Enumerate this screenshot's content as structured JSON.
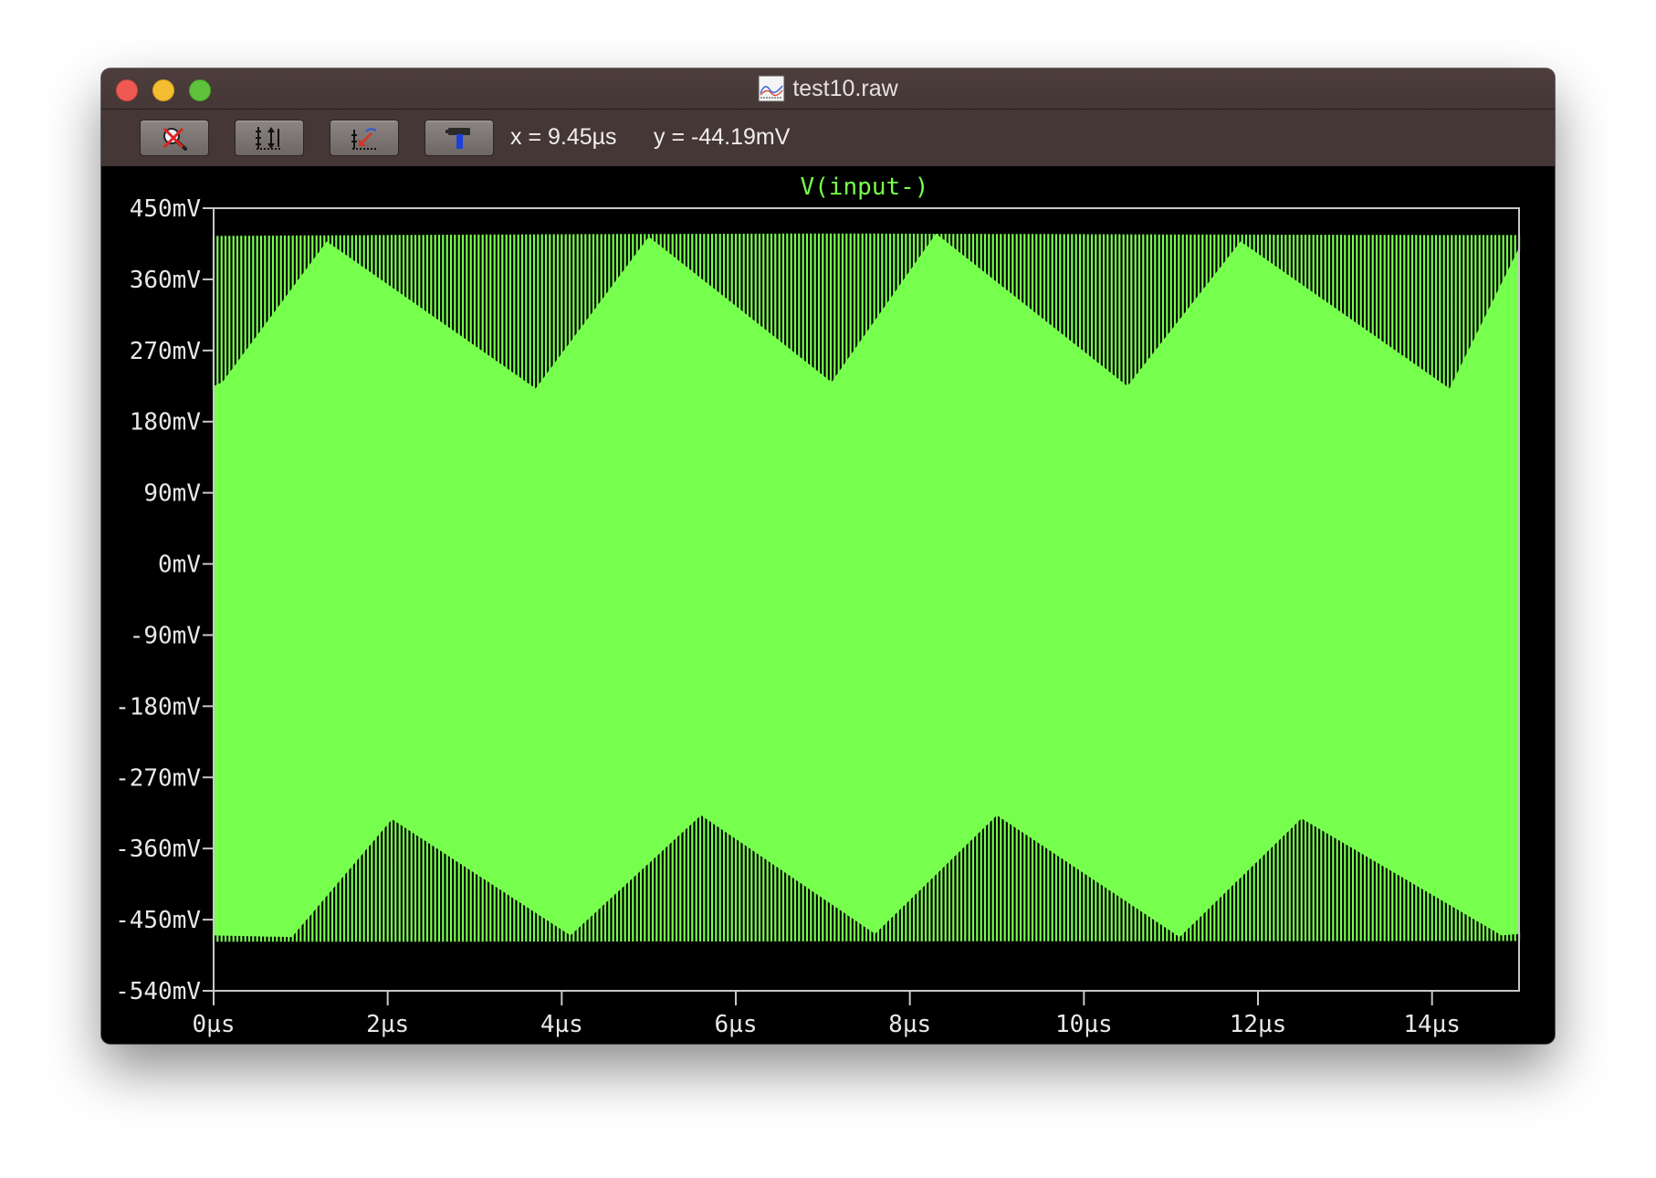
{
  "window": {
    "title": "test10.raw"
  },
  "toolbar": {
    "buttons": [
      {
        "name": "zoom-cancel",
        "icon": "magnifier-cancel-icon"
      },
      {
        "name": "autorange-y",
        "icon": "autorange-y-icon"
      },
      {
        "name": "zoom-back",
        "icon": "zoom-back-icon"
      },
      {
        "name": "settings",
        "icon": "hammer-icon"
      }
    ],
    "cursor_x": "x = 9.45µs",
    "cursor_y": "y = -44.19mV"
  },
  "colors": {
    "trace": "#77ff4e",
    "background": "#000000",
    "axis": "#c8c8c8",
    "label_text": "#e8e8e8",
    "titlebar": "#4a3b3a"
  },
  "chart_data": {
    "type": "area",
    "title": "V(input-)",
    "xlabel": "",
    "ylabel": "",
    "x_unit": "µs",
    "y_unit": "mV",
    "xlim": [
      0,
      15
    ],
    "ylim": [
      -540,
      450
    ],
    "x_ticks": [
      0,
      2,
      4,
      6,
      8,
      10,
      12,
      14
    ],
    "x_tick_labels": [
      "0µs",
      "2µs",
      "4µs",
      "6µs",
      "8µs",
      "10µs",
      "12µs",
      "14µs"
    ],
    "y_ticks": [
      450,
      360,
      270,
      180,
      90,
      0,
      -90,
      -180,
      -270,
      -360,
      -450,
      -540
    ],
    "y_tick_labels": [
      "450mV",
      "360mV",
      "270mV",
      "180mV",
      "90mV",
      "0mV",
      "-90mV",
      "-180mV",
      "-270mV",
      "-360mV",
      "-450mV",
      "-540mV"
    ],
    "grid": false,
    "series": [
      {
        "name": "V(input-)",
        "description_values": "high-frequency oscillation; envelope maxima and minima",
        "upper_peak": {
          "x": [
            0.0,
            3.7,
            7.1,
            10.5,
            14.2,
            15.0
          ],
          "y": [
            415,
            417,
            418,
            417,
            416,
            416
          ]
        },
        "upper_trough": {
          "x": [
            0.0,
            0.1,
            1.3,
            3.7,
            5.0,
            7.1,
            8.3,
            10.5,
            11.8,
            14.2,
            15.0
          ],
          "y": [
            225,
            230,
            408,
            222,
            414,
            230,
            418,
            225,
            408,
            222,
            400
          ]
        },
        "lower_peak": {
          "x": [
            0.0,
            0.9,
            2.05,
            4.1,
            5.6,
            7.6,
            9.0,
            11.1,
            12.5,
            14.8,
            15.0
          ],
          "y": [
            -470,
            -472,
            -323,
            -470,
            -318,
            -468,
            -318,
            -472,
            -322,
            -470,
            -468
          ]
        },
        "lower_trough": {
          "x": [
            0.0,
            15.0
          ],
          "y": [
            -478,
            -477
          ]
        }
      }
    ]
  }
}
